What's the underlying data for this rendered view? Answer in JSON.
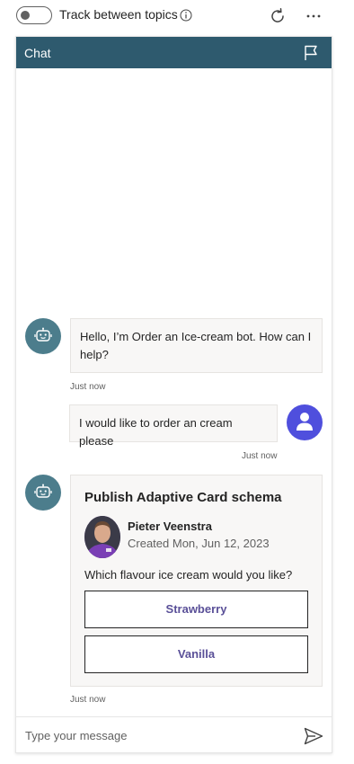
{
  "toolbar": {
    "track_label": "Track between topics",
    "toggle_state": "off",
    "icons": [
      "info-icon",
      "refresh-icon",
      "more-icon"
    ]
  },
  "chat": {
    "header_title": "Chat",
    "header_icon": "flag-icon",
    "messages": [
      {
        "from": "bot",
        "text": "Hello, I’m Order an Ice-cream bot. How can I help?",
        "timestamp": "Just now"
      },
      {
        "from": "user",
        "text": "I would like to order an cream please",
        "timestamp": "Just now"
      },
      {
        "from": "bot",
        "card": {
          "title": "Publish Adaptive Card schema",
          "author_name": "Pieter Veenstra",
          "created": "Created Mon, Jun 12, 2023",
          "question": "Which flavour ice cream would you like?",
          "choices": [
            "Strawberry",
            "Vanilla"
          ]
        },
        "timestamp": "Just now"
      }
    ],
    "input": {
      "placeholder": "Type your message",
      "value": ""
    }
  },
  "colors": {
    "header_bg": "#2e5a6e",
    "bot_avatar": "#4c7d8c",
    "user_avatar": "#4f4fdd",
    "choice_text": "#5a5098",
    "bubble_bg": "#f8f7f6"
  }
}
